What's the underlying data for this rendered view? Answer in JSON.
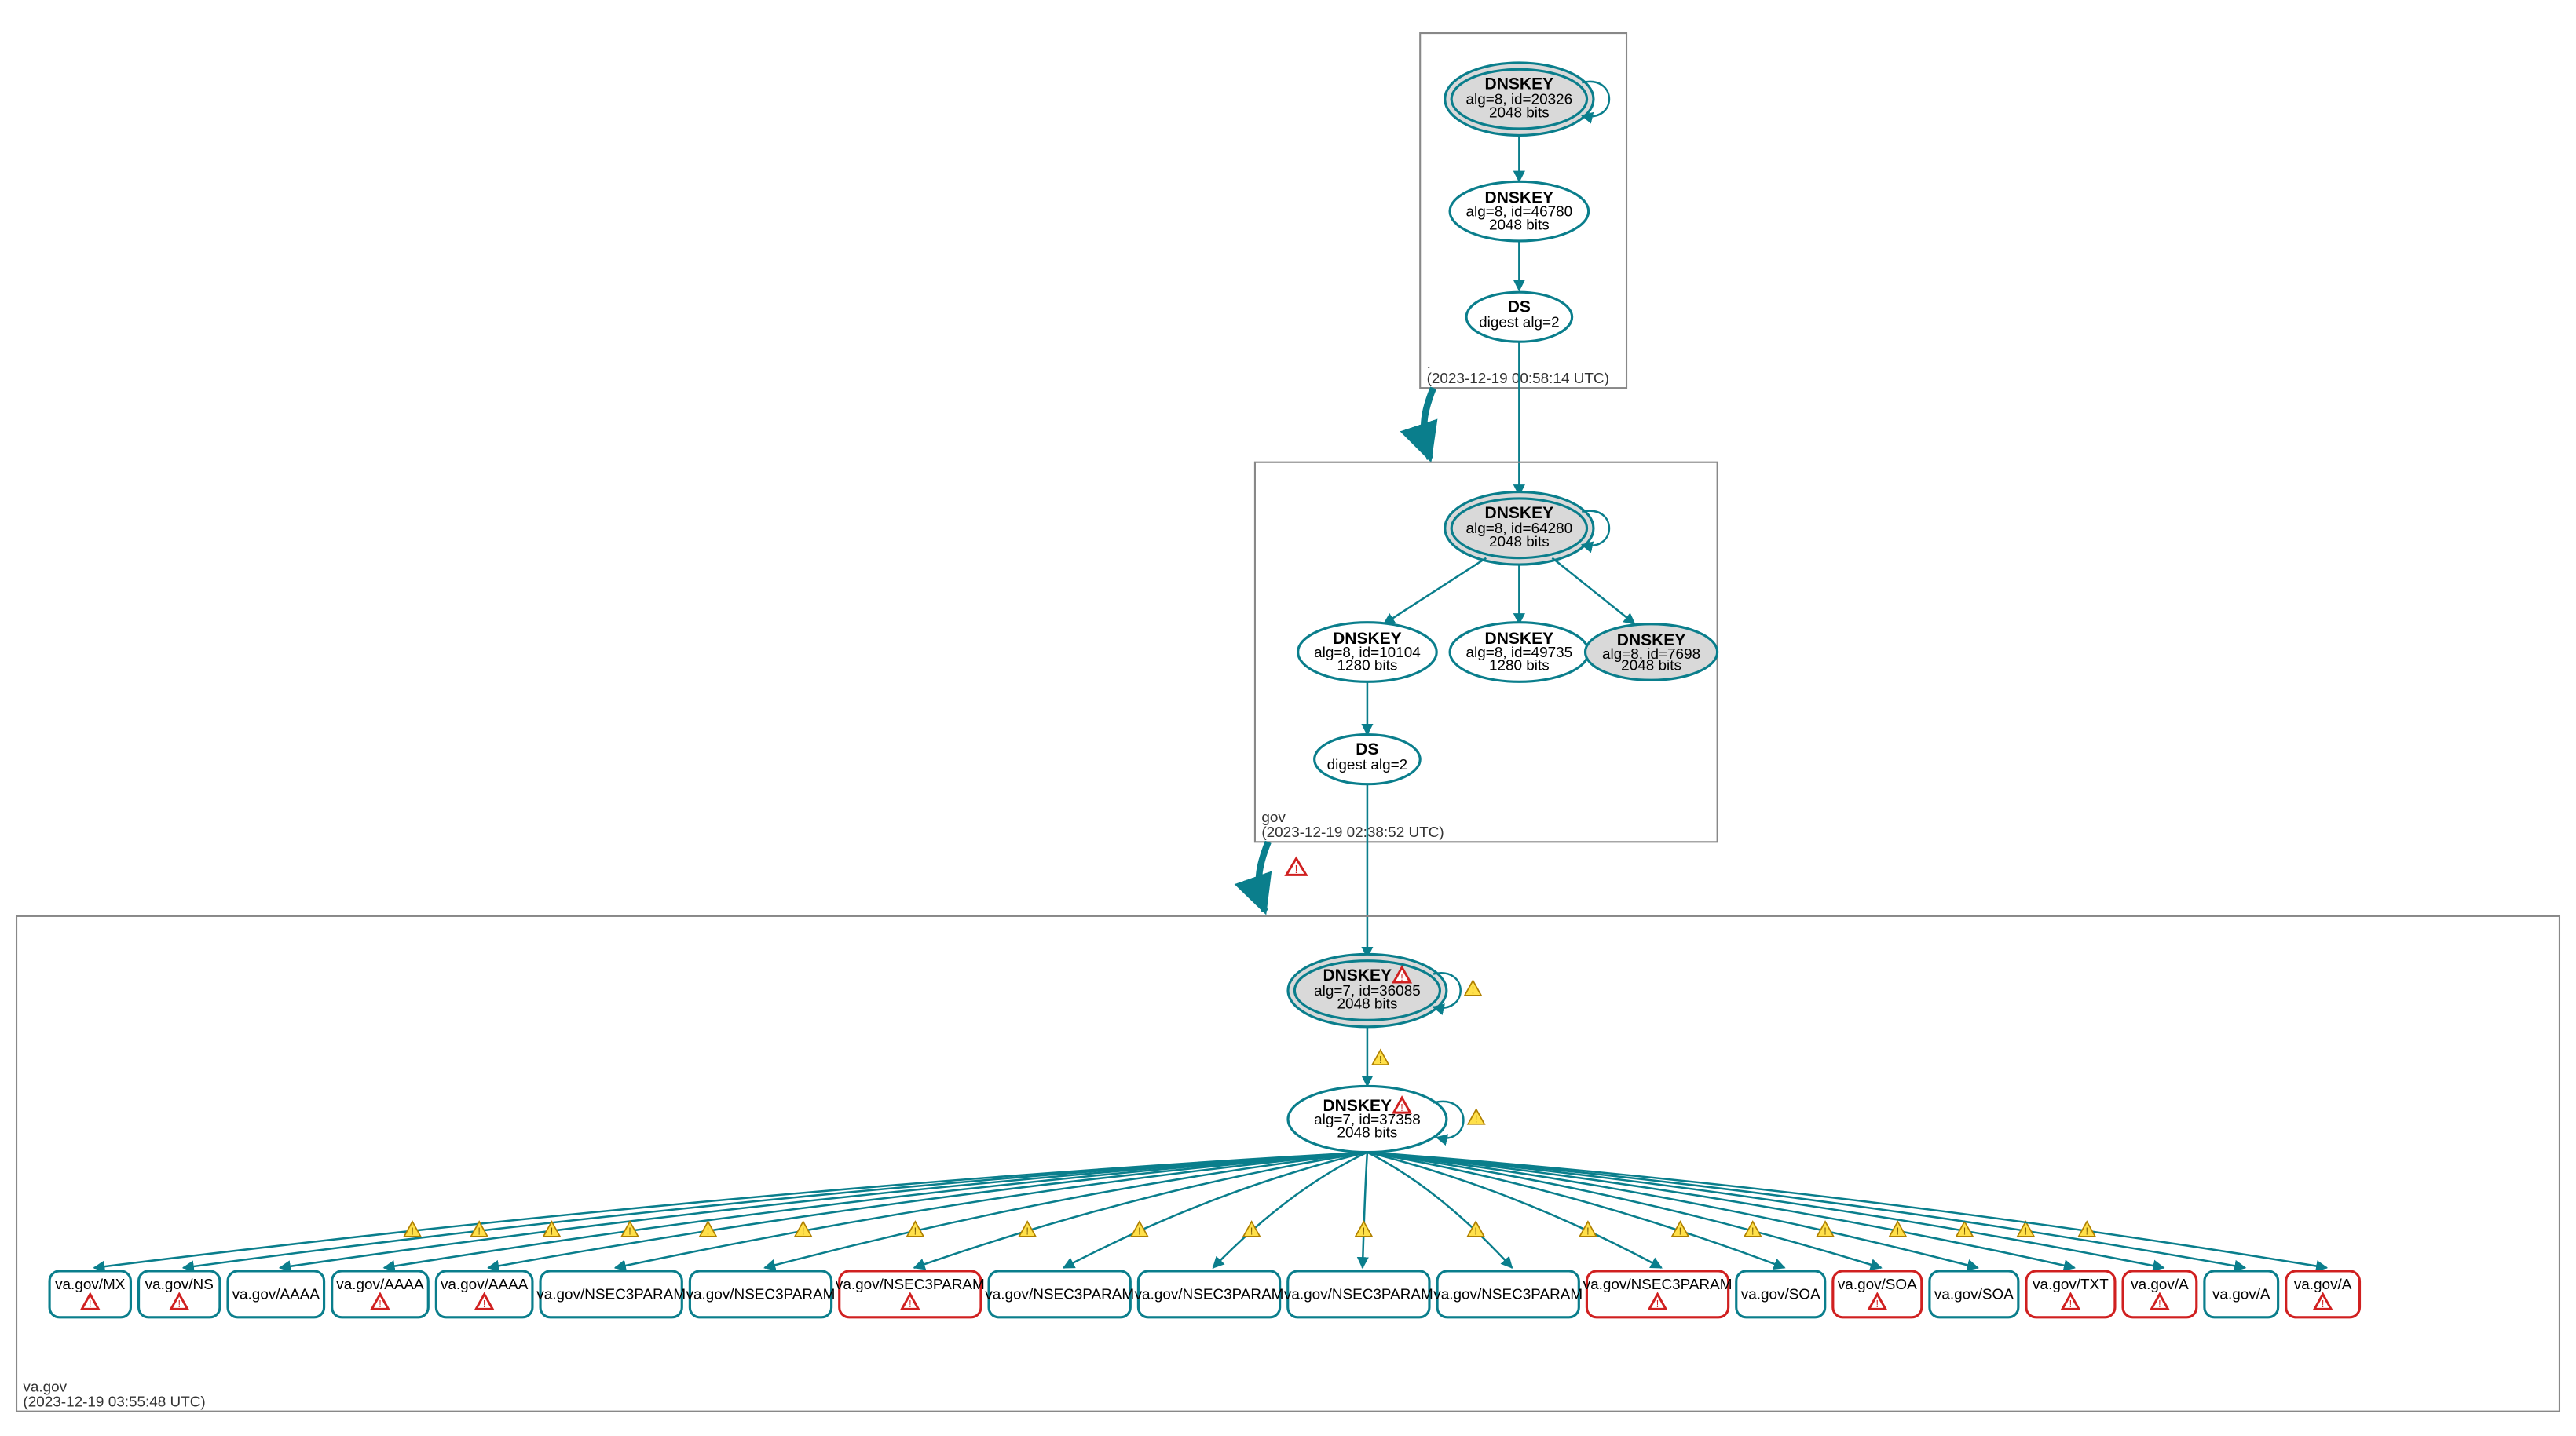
{
  "zones": {
    "root": {
      "label": ".",
      "timestamp": "(2023-12-19 00:58:14 UTC)"
    },
    "gov": {
      "label": "gov",
      "timestamp": "(2023-12-19 02:38:52 UTC)"
    },
    "vagov": {
      "label": "va.gov",
      "timestamp": "(2023-12-19 03:55:48 UTC)"
    }
  },
  "nodes": {
    "root_ksk": {
      "title": "DNSKEY",
      "line1": "alg=8, id=20326",
      "line2": "2048 bits"
    },
    "root_zsk": {
      "title": "DNSKEY",
      "line1": "alg=8, id=46780",
      "line2": "2048 bits"
    },
    "root_ds": {
      "title": "DS",
      "line1": "digest alg=2",
      "line2": ""
    },
    "gov_ksk": {
      "title": "DNSKEY",
      "line1": "alg=8, id=64280",
      "line2": "2048 bits"
    },
    "gov_zsk1": {
      "title": "DNSKEY",
      "line1": "alg=8, id=10104",
      "line2": "1280 bits"
    },
    "gov_zsk2": {
      "title": "DNSKEY",
      "line1": "alg=8, id=49735",
      "line2": "1280 bits"
    },
    "gov_ksk2": {
      "title": "DNSKEY",
      "line1": "alg=8, id=7698",
      "line2": "2048 bits"
    },
    "gov_ds": {
      "title": "DS",
      "line1": "digest alg=2",
      "line2": ""
    },
    "va_ksk": {
      "title": "DNSKEY",
      "line1": "alg=7, id=36085",
      "line2": "2048 bits"
    },
    "va_zsk": {
      "title": "DNSKEY",
      "line1": "alg=7, id=37358",
      "line2": "2048 bits"
    }
  },
  "leaves": [
    {
      "label": "va.gov/MX",
      "error": true
    },
    {
      "label": "va.gov/NS",
      "error": true
    },
    {
      "label": "va.gov/AAAA",
      "error": false
    },
    {
      "label": "va.gov/AAAA",
      "error": true
    },
    {
      "label": "va.gov/AAAA",
      "error": true
    },
    {
      "label": "va.gov/NSEC3PARAM",
      "error": false
    },
    {
      "label": "va.gov/NSEC3PARAM",
      "error": false
    },
    {
      "label": "va.gov/NSEC3PARAM",
      "error": true,
      "red": true
    },
    {
      "label": "va.gov/NSEC3PARAM",
      "error": false
    },
    {
      "label": "va.gov/NSEC3PARAM",
      "error": false
    },
    {
      "label": "va.gov/NSEC3PARAM",
      "error": false
    },
    {
      "label": "va.gov/NSEC3PARAM",
      "error": false
    },
    {
      "label": "va.gov/NSEC3PARAM",
      "error": true,
      "red": true
    },
    {
      "label": "va.gov/SOA",
      "error": false
    },
    {
      "label": "va.gov/SOA",
      "error": true,
      "red": true
    },
    {
      "label": "va.gov/SOA",
      "error": false
    },
    {
      "label": "va.gov/TXT",
      "error": true,
      "red": true
    },
    {
      "label": "va.gov/A",
      "error": true,
      "red": true
    },
    {
      "label": "va.gov/A",
      "error": false
    },
    {
      "label": "va.gov/A",
      "error": true,
      "red": true
    }
  ],
  "colors": {
    "teal": "#0a7e8c",
    "red": "#d02020",
    "yellow": "#ffe04a"
  }
}
